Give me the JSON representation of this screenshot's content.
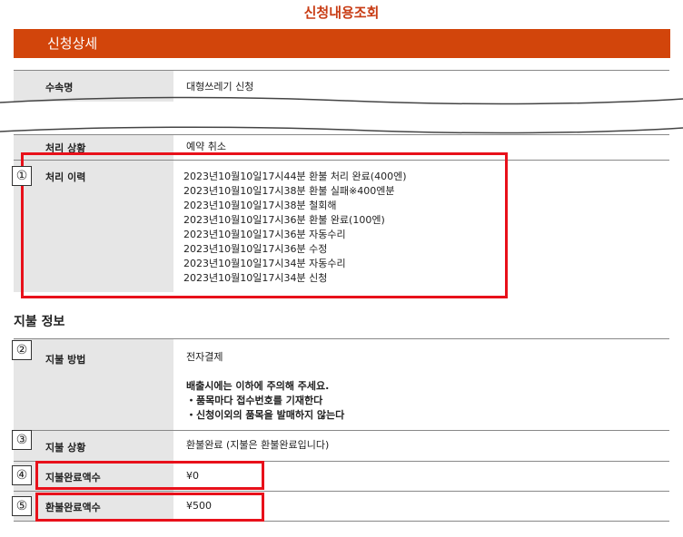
{
  "page_title": "신청내용조회",
  "section_title": "신청상세",
  "rows": {
    "item_name": {
      "label": "수속명",
      "value": "대형쓰레기 신청"
    },
    "status": {
      "label": "처리 상황",
      "value": "예약 취소"
    },
    "history": {
      "label": "처리 이력",
      "entries": [
        "2023년10월10일17시44분 환불 처리 완료(400엔)",
        "2023년10월10일17시38분 환불 실패※400엔분",
        "2023년10월10일17시38분 철회해",
        "2023년10월10일17시36분 환불 완료(100엔)",
        "2023년10월10일17시36분 자동수리",
        "2023년10월10일17시36분 수정",
        "2023년10월10일17시34분 자동수리",
        "2023년10월10일17시34분 신청"
      ]
    }
  },
  "payment": {
    "title": "지불 정보",
    "method": {
      "label": "지불 방법",
      "value": "전자결제",
      "notice": [
        "배출시에는 이하에 주의해 주세요.",
        "・품목마다 접수번호를 기재한다",
        "・신청이외의 품목을 발매하지 않는다"
      ]
    },
    "status": {
      "label": "지불 상황",
      "value": "환불완료 (지불은 환불완료입니다)"
    },
    "paid_amount": {
      "label": "지불완료액수",
      "value": "¥0"
    },
    "refund_amount": {
      "label": "환불완료액수",
      "value": "¥500"
    }
  },
  "markers": [
    "①",
    "②",
    "③",
    "④",
    "⑤"
  ],
  "colors": {
    "accent": "#d2450b",
    "title": "#c83c14",
    "highlight": "#e8101a",
    "notice": "#1a5ec4"
  }
}
